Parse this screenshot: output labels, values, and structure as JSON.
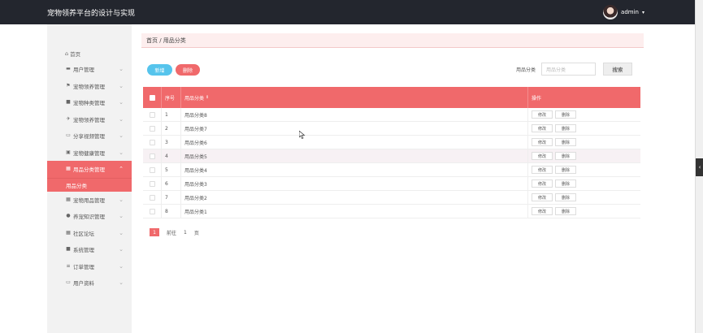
{
  "app": {
    "title": "宠物领养平台的设计与实现"
  },
  "user": {
    "name": "admin",
    "caret": "▾"
  },
  "sidebar": {
    "home": "首页",
    "items": [
      {
        "label": "用户管理",
        "icon": "▬"
      },
      {
        "label": "宠物领养管理",
        "icon": "⚑"
      },
      {
        "label": "宠物种类管理",
        "icon": "■"
      },
      {
        "label": "宠物领养管理",
        "icon": "✈"
      },
      {
        "label": "分享视频管理",
        "icon": "▭"
      },
      {
        "label": "宠物健康管理",
        "icon": "▣"
      },
      {
        "label": "用品分类管理",
        "icon": "▦"
      }
    ],
    "active_sub": "用品分类",
    "items2": [
      {
        "label": "宠物用品管理",
        "icon": "▦"
      },
      {
        "label": "养宠知识管理",
        "icon": "●"
      },
      {
        "label": "社区论坛",
        "icon": "▦"
      },
      {
        "label": "系统管理",
        "icon": "■"
      },
      {
        "label": "订单管理",
        "icon": "≡"
      },
      {
        "label": "用户资料",
        "icon": "▭"
      }
    ],
    "chevron": "⌄",
    "chevron_up": "⌃"
  },
  "breadcrumb": "首页 / 用品分类",
  "toolbar": {
    "add_label": "新增",
    "delete_label": "删除",
    "search_label": "用品分类",
    "search_placeholder": "用品分类",
    "search_button": "搜索"
  },
  "table": {
    "headers": {
      "no": "序号",
      "name": "用品分类",
      "sort": "⇕",
      "op": "操作"
    },
    "rows": [
      {
        "no": "1",
        "name": "用品分类8"
      },
      {
        "no": "2",
        "name": "用品分类7"
      },
      {
        "no": "3",
        "name": "用品分类6"
      },
      {
        "no": "4",
        "name": "用品分类5"
      },
      {
        "no": "5",
        "name": "用品分类4"
      },
      {
        "no": "6",
        "name": "用品分类3"
      },
      {
        "no": "7",
        "name": "用品分类2"
      },
      {
        "no": "8",
        "name": "用品分类1"
      }
    ],
    "edit_label": "修改",
    "del_label": "删除"
  },
  "pager": {
    "current": "1",
    "goto": "前往",
    "page_input": "1",
    "page_unit": "页"
  },
  "scroll": {
    "collapse": "‹"
  },
  "colors": {
    "accent": "#f0696b",
    "blue": "#56c4ec",
    "topbar": "#23262e"
  }
}
